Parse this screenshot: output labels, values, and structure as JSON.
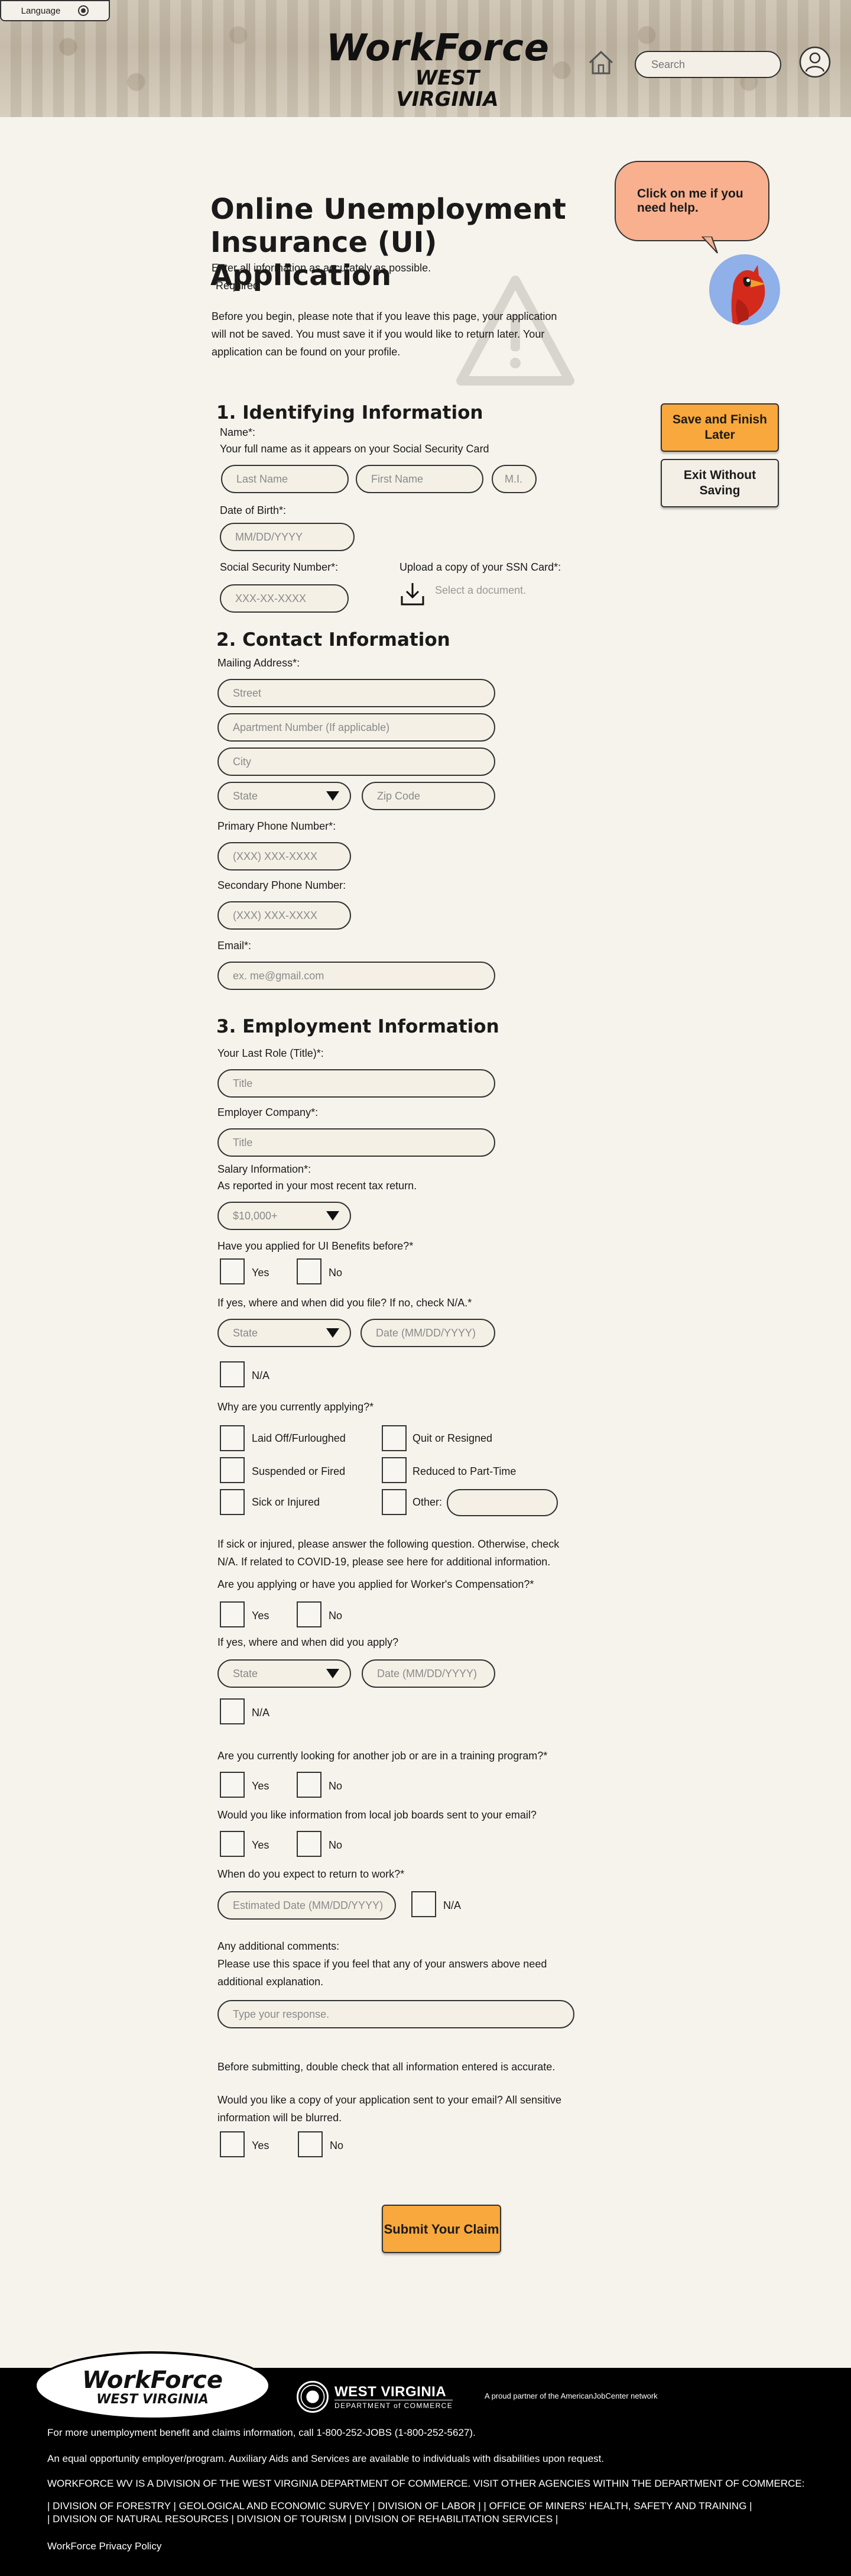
{
  "header": {
    "language_label": "Language",
    "logo_line1": "WorkForce",
    "logo_line2": "WEST VIRGINIA",
    "search_placeholder": "Search"
  },
  "intro": {
    "title": "Online Unemployment Insurance (UI) Application",
    "accuracy": "Enter all information as accurately as possible.",
    "required": "*Required",
    "before_you_begin": "Before you begin, please note that if you leave this page, your application will not be saved. You must save it if you would like to return later. Your application can be found on your profile."
  },
  "helper": {
    "bubble_text": "Click on me if you need help."
  },
  "actions": {
    "save_label": "Save and Finish Later",
    "exit_label": "Exit Without Saving",
    "submit_label": "Submit Your Claim"
  },
  "section1": {
    "heading": "1. Identifying Information",
    "name_label": "Name*:",
    "name_hint": "Your full name as it appears on your Social Security Card",
    "last_name_placeholder": "Last Name",
    "first_name_placeholder": "First Name",
    "mi_placeholder": "M.I.",
    "dob_label": "Date of Birth*:",
    "dob_placeholder": "MM/DD/YYYY",
    "ssn_label": "Social Security Number*:",
    "ssn_placeholder": "XXX-XX-XXXX",
    "upload_label": "Upload a copy of your SSN Card*:",
    "upload_placeholder": "Select a document."
  },
  "section2": {
    "heading": "2. Contact Information",
    "mailing_label": "Mailing Address*:",
    "street_placeholder": "Street",
    "apt_placeholder": "Apartment Number (If applicable)",
    "city_placeholder": "City",
    "state_value": "State",
    "zip_placeholder": "Zip Code",
    "primary_phone_label": "Primary Phone Number*:",
    "phone_placeholder": "(XXX) XXX-XXXX",
    "secondary_phone_label": "Secondary Phone Number:",
    "email_label": "Email*:",
    "email_placeholder": "ex. me@gmail.com"
  },
  "section3": {
    "heading": "3. Employment Information",
    "role_label": "Your Last Role (Title)*:",
    "title_placeholder": "Title",
    "company_label": "Employer Company*:",
    "salary_label": "Salary Information*:",
    "salary_hint": "As reported in your most recent tax return.",
    "salary_value": "$10,000+",
    "ui_before_q": "Have you applied for UI Benefits before?*",
    "yes": "Yes",
    "no": "No",
    "na": "N/A",
    "filed_q": "If yes, where and when did you file? If no, check N/A.*",
    "state_value": "State",
    "date_placeholder": "Date (MM/DD/YYYY)",
    "why_q": "Why are you currently applying?*",
    "reasons": {
      "laid_off": "Laid Off/Furloughed",
      "quit": "Quit or Resigned",
      "suspended": "Suspended or Fired",
      "reduced": "Reduced to Part-Time",
      "sick": "Sick or Injured",
      "other": "Other:"
    },
    "sick_note": "If sick or injured, please answer the following question. Otherwise, check N/A. If related to COVID-19, please see here for additional information.",
    "comp_q": "Are you applying or have you applied for Worker's Compensation?*",
    "comp_when_q": "If yes, where and when did you apply?",
    "looking_q": "Are you currently looking for another job or are in a training program?*",
    "boards_q": "Would you like information from local job boards sent to your email?",
    "return_q": "When do you expect to return to work?*",
    "return_placeholder": "Estimated Date (MM/DD/YYYY)",
    "comments_label": "Any additional comments:",
    "comments_hint": "Please use this space if you feel that any of your answers above need additional explanation.",
    "comments_placeholder": "Type your response.",
    "double_check": "Before submitting, double check that all information entered is accurate.",
    "copy_q": "Would you like a copy of your application sent to your email? All sensitive information will be blurred."
  },
  "footer": {
    "logo_line1": "WorkForce",
    "logo_line2": "WEST VIRGINIA",
    "wv_name": "WEST VIRGINIA",
    "wv_dept": "DEPARTMENT of COMMERCE",
    "ajc_text": "A proud partner of the AmericanJobCenter network",
    "line1": "For more unemployment benefit and claims information, call 1-800-252-JOBS (1-800-252-5627).",
    "line2": "An equal opportunity employer/program. Auxiliary Aids and Services are available to individuals with disabilities upon request.",
    "line3": "WORKFORCE WV IS A DIVISION OF THE WEST VIRGINIA DEPARTMENT OF COMMERCE. VISIT OTHER AGENCIES WITHIN THE DEPARTMENT OF COMMERCE:",
    "line4": "| DIVISION OF FORESTRY  | GEOLOGICAL AND ECONOMIC SURVEY  | DIVISION OF LABOR | | OFFICE OF MINERS' HEALTH, SAFETY AND TRAINING |",
    "line5": "| DIVISION OF NATURAL RESOURCES | DIVISION OF TOURISM  | DIVISION OF REHABILITATION SERVICES |",
    "privacy": "WorkForce Privacy Policy"
  }
}
